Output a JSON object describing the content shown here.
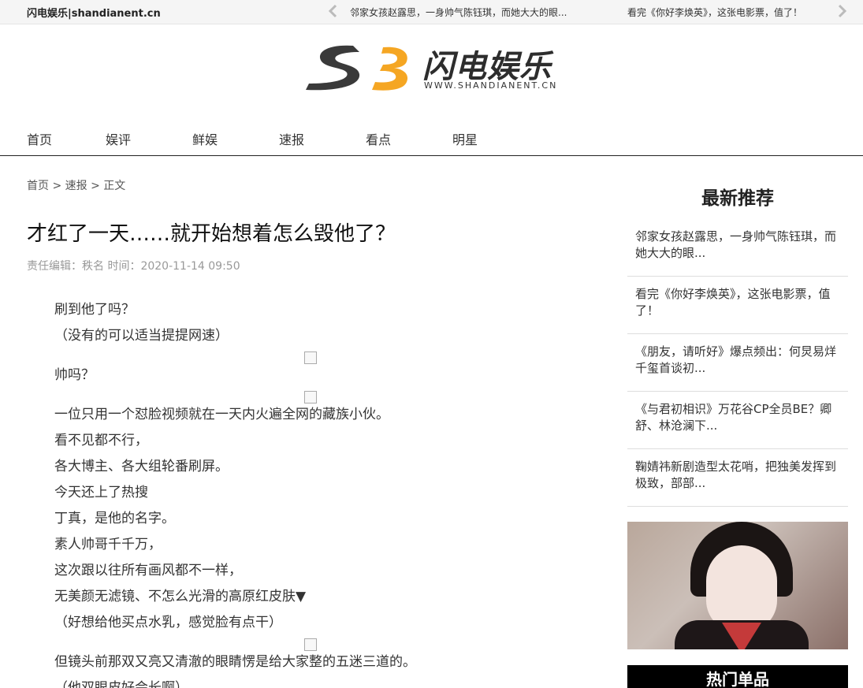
{
  "topbar": {
    "site_name": "闪电娱乐|shandianent.cn",
    "ticker": [
      "邻家女孩赵露思，一身帅气陈钰琪，而她大大的眼...",
      "看完《你好李焕英》，这张电影票，值了！"
    ]
  },
  "logo": {
    "name": "闪电娱乐",
    "url": "WWW.SHANDIANENT.CN"
  },
  "colors": {
    "brand_orange": "#f5a623",
    "logo_dark": "#3a3a3a"
  },
  "nav": {
    "items": [
      "首页",
      "娱评",
      "鲜娱",
      "速报",
      "看点",
      "明星"
    ]
  },
  "breadcrumb": {
    "home": "首页",
    "sep1": ">",
    "section": "速报",
    "sep2": ">",
    "current": "正文"
  },
  "article": {
    "title": "才红了一天……就开始想着怎么毁他了？",
    "meta": "责任编辑：秩名   时间：2020-11-14 09:50",
    "paragraphs": [
      "刷到他了吗？",
      "（没有的可以适当提提网速）",
      "帅吗？",
      "一位只用一个怼脸视频就在一天内火遍全网的藏族小伙。",
      "看不见都不行，",
      "各大博主、各大组轮番刷屏。",
      "今天还上了热搜",
      "丁真，是他的名字。",
      "素人帅哥千千万，",
      "这次跟以往所有画风都不一样，",
      "无美颜无滤镜、不怎么光滑的高原红皮肤▼",
      "（好想给他买点水乳，感觉脸有点干）",
      "但镜头前那双又亮又清澈的眼睛愣是给大家整的五迷三道的。",
      "（他双眼皮好会长啊）"
    ]
  },
  "sidebar": {
    "title": "最新推荐",
    "items": [
      "邻家女孩赵露思，一身帅气陈钰琪，而她大大的眼...",
      "看完《你好李焕英》，这张电影票，值了！",
      "《朋友，请听好》爆点频出：何炅易烊千玺首谈初...",
      "《与君初相识》万花谷CP全员BE？卿舒、林沧澜下...",
      "鞠婧祎新剧造型太花哨，把独美发挥到极致，部部..."
    ],
    "hot_title": "热门单品"
  }
}
